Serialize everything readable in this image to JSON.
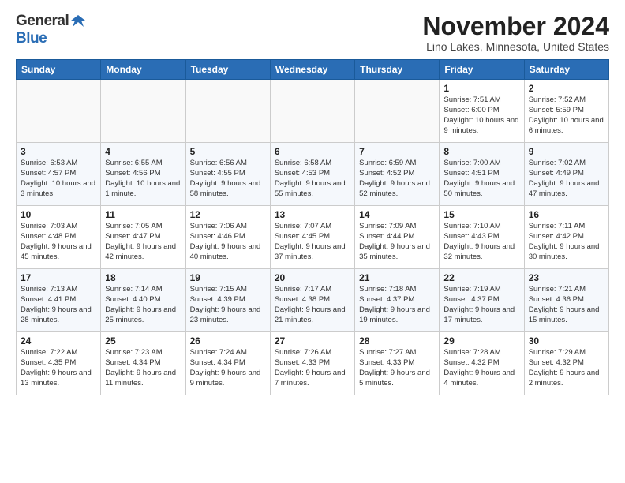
{
  "logo": {
    "general": "General",
    "blue": "Blue"
  },
  "title": "November 2024",
  "location": "Lino Lakes, Minnesota, United States",
  "weekdays": [
    "Sunday",
    "Monday",
    "Tuesday",
    "Wednesday",
    "Thursday",
    "Friday",
    "Saturday"
  ],
  "weeks": [
    [
      {
        "day": "",
        "info": ""
      },
      {
        "day": "",
        "info": ""
      },
      {
        "day": "",
        "info": ""
      },
      {
        "day": "",
        "info": ""
      },
      {
        "day": "",
        "info": ""
      },
      {
        "day": "1",
        "info": "Sunrise: 7:51 AM\nSunset: 6:00 PM\nDaylight: 10 hours and 9 minutes."
      },
      {
        "day": "2",
        "info": "Sunrise: 7:52 AM\nSunset: 5:59 PM\nDaylight: 10 hours and 6 minutes."
      }
    ],
    [
      {
        "day": "3",
        "info": "Sunrise: 6:53 AM\nSunset: 4:57 PM\nDaylight: 10 hours and 3 minutes."
      },
      {
        "day": "4",
        "info": "Sunrise: 6:55 AM\nSunset: 4:56 PM\nDaylight: 10 hours and 1 minute."
      },
      {
        "day": "5",
        "info": "Sunrise: 6:56 AM\nSunset: 4:55 PM\nDaylight: 9 hours and 58 minutes."
      },
      {
        "day": "6",
        "info": "Sunrise: 6:58 AM\nSunset: 4:53 PM\nDaylight: 9 hours and 55 minutes."
      },
      {
        "day": "7",
        "info": "Sunrise: 6:59 AM\nSunset: 4:52 PM\nDaylight: 9 hours and 52 minutes."
      },
      {
        "day": "8",
        "info": "Sunrise: 7:00 AM\nSunset: 4:51 PM\nDaylight: 9 hours and 50 minutes."
      },
      {
        "day": "9",
        "info": "Sunrise: 7:02 AM\nSunset: 4:49 PM\nDaylight: 9 hours and 47 minutes."
      }
    ],
    [
      {
        "day": "10",
        "info": "Sunrise: 7:03 AM\nSunset: 4:48 PM\nDaylight: 9 hours and 45 minutes."
      },
      {
        "day": "11",
        "info": "Sunrise: 7:05 AM\nSunset: 4:47 PM\nDaylight: 9 hours and 42 minutes."
      },
      {
        "day": "12",
        "info": "Sunrise: 7:06 AM\nSunset: 4:46 PM\nDaylight: 9 hours and 40 minutes."
      },
      {
        "day": "13",
        "info": "Sunrise: 7:07 AM\nSunset: 4:45 PM\nDaylight: 9 hours and 37 minutes."
      },
      {
        "day": "14",
        "info": "Sunrise: 7:09 AM\nSunset: 4:44 PM\nDaylight: 9 hours and 35 minutes."
      },
      {
        "day": "15",
        "info": "Sunrise: 7:10 AM\nSunset: 4:43 PM\nDaylight: 9 hours and 32 minutes."
      },
      {
        "day": "16",
        "info": "Sunrise: 7:11 AM\nSunset: 4:42 PM\nDaylight: 9 hours and 30 minutes."
      }
    ],
    [
      {
        "day": "17",
        "info": "Sunrise: 7:13 AM\nSunset: 4:41 PM\nDaylight: 9 hours and 28 minutes."
      },
      {
        "day": "18",
        "info": "Sunrise: 7:14 AM\nSunset: 4:40 PM\nDaylight: 9 hours and 25 minutes."
      },
      {
        "day": "19",
        "info": "Sunrise: 7:15 AM\nSunset: 4:39 PM\nDaylight: 9 hours and 23 minutes."
      },
      {
        "day": "20",
        "info": "Sunrise: 7:17 AM\nSunset: 4:38 PM\nDaylight: 9 hours and 21 minutes."
      },
      {
        "day": "21",
        "info": "Sunrise: 7:18 AM\nSunset: 4:37 PM\nDaylight: 9 hours and 19 minutes."
      },
      {
        "day": "22",
        "info": "Sunrise: 7:19 AM\nSunset: 4:37 PM\nDaylight: 9 hours and 17 minutes."
      },
      {
        "day": "23",
        "info": "Sunrise: 7:21 AM\nSunset: 4:36 PM\nDaylight: 9 hours and 15 minutes."
      }
    ],
    [
      {
        "day": "24",
        "info": "Sunrise: 7:22 AM\nSunset: 4:35 PM\nDaylight: 9 hours and 13 minutes."
      },
      {
        "day": "25",
        "info": "Sunrise: 7:23 AM\nSunset: 4:34 PM\nDaylight: 9 hours and 11 minutes."
      },
      {
        "day": "26",
        "info": "Sunrise: 7:24 AM\nSunset: 4:34 PM\nDaylight: 9 hours and 9 minutes."
      },
      {
        "day": "27",
        "info": "Sunrise: 7:26 AM\nSunset: 4:33 PM\nDaylight: 9 hours and 7 minutes."
      },
      {
        "day": "28",
        "info": "Sunrise: 7:27 AM\nSunset: 4:33 PM\nDaylight: 9 hours and 5 minutes."
      },
      {
        "day": "29",
        "info": "Sunrise: 7:28 AM\nSunset: 4:32 PM\nDaylight: 9 hours and 4 minutes."
      },
      {
        "day": "30",
        "info": "Sunrise: 7:29 AM\nSunset: 4:32 PM\nDaylight: 9 hours and 2 minutes."
      }
    ]
  ]
}
